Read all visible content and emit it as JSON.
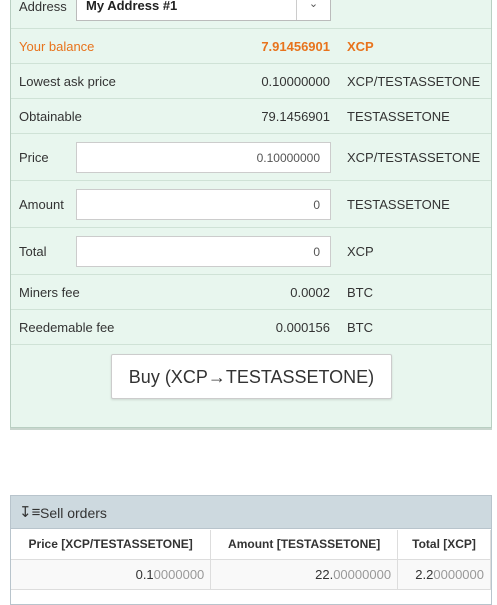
{
  "form": {
    "address_label": "Address",
    "address_value": "My Address #1",
    "balance": {
      "label": "Your balance",
      "value": "7.91456901",
      "unit": "XCP"
    },
    "lowest_ask": {
      "label": "Lowest ask price",
      "value": "0.10000000",
      "unit": "XCP/TESTASSETONE"
    },
    "obtainable": {
      "label": "Obtainable",
      "value": "79.1456901",
      "unit": "TESTASSETONE"
    },
    "price": {
      "label": "Price",
      "value": "0.10000000",
      "unit": "XCP/TESTASSETONE"
    },
    "amount": {
      "label": "Amount",
      "value": "0",
      "unit": "TESTASSETONE"
    },
    "total": {
      "label": "Total",
      "value": "0",
      "unit": "XCP"
    },
    "miners_fee": {
      "label": "Miners fee",
      "value": "0.0002",
      "unit": "BTC"
    },
    "redeemable_fee": {
      "label": "Reedemable fee",
      "value": "0.000156",
      "unit": "BTC"
    },
    "buy_button": "Buy (XCP→TESTASSETONE)"
  },
  "sell_orders": {
    "title": "Sell orders",
    "columns": [
      "Price [XCP/TESTASSETONE]",
      "Amount [TESTASSETONE]",
      "Total [XCP]"
    ],
    "rows": [
      {
        "price": {
          "main": "0.1",
          "dim": "0000000"
        },
        "amount": {
          "main": "22.",
          "dim": "00000000"
        },
        "total": {
          "main": "2.2",
          "dim": "0000000"
        }
      }
    ]
  },
  "colors": {
    "balance": "#e8731c",
    "panel_bg": "#e8f6ee",
    "header_bg": "#cdd9df"
  },
  "icons": {
    "select_caret": "chevron-down-icon",
    "sort": "sort-desc-icon"
  }
}
